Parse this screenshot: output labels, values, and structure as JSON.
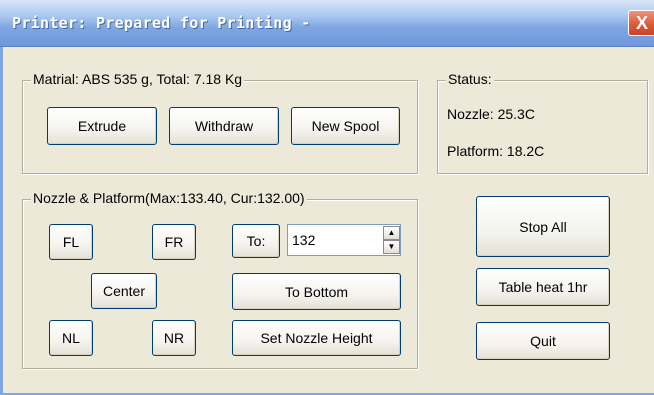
{
  "window": {
    "title": "Printer: Prepared for Printing -",
    "close_symbol": "X"
  },
  "material": {
    "legend": "Matrial: ABS 535 g,  Total: 7.18 Kg",
    "buttons": {
      "extrude": "Extrude",
      "withdraw": "Withdraw",
      "new_spool": "New Spool"
    }
  },
  "status": {
    "legend": "Status:",
    "nozzle": "Nozzle: 25.3C",
    "platform": "Platform: 18.2C"
  },
  "nozzle_platform": {
    "legend": "Nozzle & Platform(Max:133.40, Cur:132.00)",
    "buttons": {
      "fl": "FL",
      "fr": "FR",
      "to": "To:",
      "center": "Center",
      "to_bottom": "To Bottom",
      "nl": "NL",
      "nr": "NR",
      "set_nozzle_height": "Set Nozzle Height"
    },
    "height_value": "132"
  },
  "actions": {
    "stop_all": "Stop All",
    "table_heat": "Table heat 1hr",
    "quit": "Quit"
  },
  "icons": {
    "spin_up": "spin-up-arrow-icon",
    "spin_down": "spin-down-arrow-icon",
    "close": "close-icon"
  }
}
